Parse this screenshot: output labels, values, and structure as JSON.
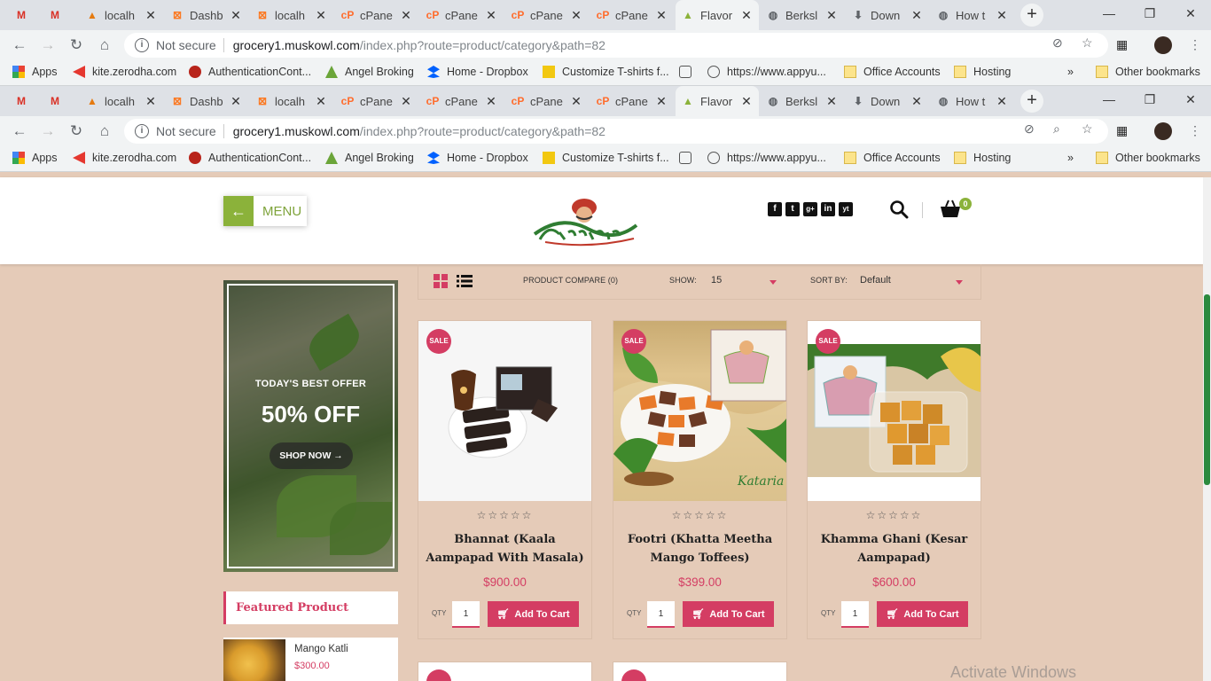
{
  "browser": {
    "tabs": [
      {
        "title": "",
        "icon": "gmail-icon"
      },
      {
        "title": "",
        "icon": "gmail-icon"
      },
      {
        "title": "localh",
        "icon": "phpmyadmin-icon"
      },
      {
        "title": "Dashb",
        "icon": "xampp-icon"
      },
      {
        "title": "localh",
        "icon": "xampp-icon"
      },
      {
        "title": "cPane",
        "icon": "cpanel-icon"
      },
      {
        "title": "cPane",
        "icon": "cpanel-icon"
      },
      {
        "title": "cPane",
        "icon": "cpanel-icon"
      },
      {
        "title": "cPane",
        "icon": "cpanel-icon"
      },
      {
        "title": "Flavor",
        "icon": "shop-bag-icon"
      },
      {
        "title": "Berksl",
        "icon": "globe-icon"
      },
      {
        "title": "Down",
        "icon": "download-icon"
      },
      {
        "title": "How t",
        "icon": "globe-icon"
      }
    ],
    "address": {
      "security": "Not secure",
      "domain": "grocery1.muskowl.com",
      "path": "/index.php?route=product/category&path=82"
    },
    "bookmarks": [
      {
        "label": "Apps",
        "icon": "apps-grid-icon"
      },
      {
        "label": "kite.zerodha.com",
        "icon": "kite-icon"
      },
      {
        "label": "AuthenticationCont...",
        "icon": "auth-icon"
      },
      {
        "label": "Angel Broking",
        "icon": "angel-icon"
      },
      {
        "label": "Home - Dropbox",
        "icon": "dropbox-icon"
      },
      {
        "label": "Customize T-shirts f...",
        "icon": "tshirt-icon"
      },
      {
        "label": "",
        "icon": "link-icon"
      },
      {
        "label": "https://www.appyu...",
        "icon": "globe-icon"
      },
      {
        "label": "Office Accounts",
        "icon": "folder-icon"
      },
      {
        "label": "Hosting",
        "icon": "folder-icon"
      },
      {
        "label": "»",
        "icon": ""
      },
      {
        "label": "Other bookmarks",
        "icon": "folder-icon"
      }
    ]
  },
  "header": {
    "menu_label": "MENU",
    "cart_count": "0",
    "social": [
      "f",
      "t",
      "g+",
      "in",
      "yt"
    ]
  },
  "banner": {
    "eyebrow": "TODAY'S BEST OFFER",
    "headline": "50% OFF",
    "cta": "SHOP NOW →"
  },
  "featured": {
    "heading": "Featured Product",
    "items": [
      {
        "name": "Mango Katli",
        "price": "$300.00"
      }
    ]
  },
  "listing": {
    "compare": "PRODUCT COMPARE (0)",
    "show_label": "SHOW:",
    "show_value": "15",
    "sort_label": "SORT BY:",
    "sort_value": "Default"
  },
  "products": [
    {
      "name": "Bhannat (Kaala Aampapad With Masala)",
      "price": "$900.00",
      "badge": "SALE",
      "qty": "1",
      "qty_label": "QTY",
      "button": "Add To Cart",
      "rating": "☆☆☆☆☆"
    },
    {
      "name": "Footri (Khatta Meetha Mango Toffees)",
      "price": "$399.00",
      "badge": "SALE",
      "qty": "1",
      "qty_label": "QTY",
      "button": "Add To Cart",
      "rating": "☆☆☆☆☆"
    },
    {
      "name": "Khamma Ghani (Kesar Aampapad)",
      "price": "$600.00",
      "badge": "SALE",
      "qty": "1",
      "qty_label": "QTY",
      "button": "Add To Cart",
      "rating": "☆☆☆☆☆"
    }
  ],
  "watermark": "Activate Windows",
  "colors": {
    "accent": "#d43d63",
    "brand_green": "#8bb23a",
    "page_bg": "#e5cbb8"
  }
}
